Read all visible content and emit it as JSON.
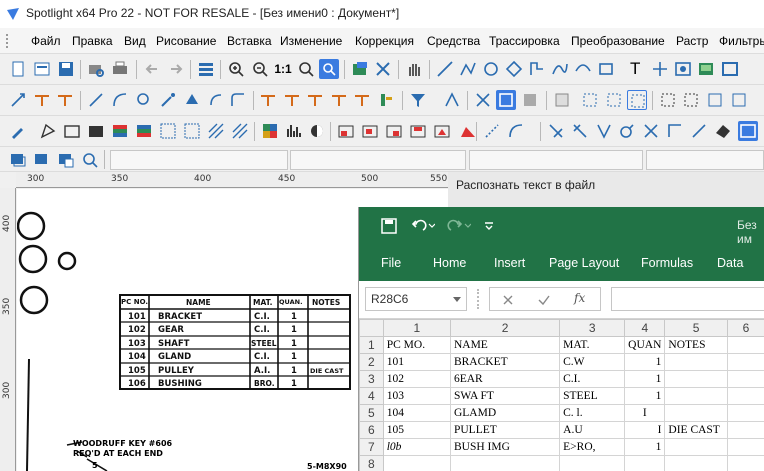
{
  "app": {
    "title": "Spotlight x64 Pro 22 - NOT FOR RESALE - [Без имени0 : Документ*]"
  },
  "menu": [
    "Файл",
    "Правка",
    "Вид",
    "Рисование",
    "Вставка",
    "Изменение",
    "Коррекция",
    "Средства",
    "Трассировка",
    "Преобразование",
    "Растр",
    "Фильтры"
  ],
  "toolbar_icons": {
    "row1": [
      "menu-grip-icon",
      "new-doc-icon",
      "open-icon",
      "save-icon",
      "print-preview-icon",
      "print-icon",
      "back-arrow-icon",
      "forward-arrow-icon",
      "layers-icon",
      "zoom-in-icon",
      "zoom-out-icon",
      "zoom-1to1-icon",
      "zoom-fit-icon",
      "zoom-window-icon",
      "image-icon",
      "transform-icon",
      "pan-hand-icon",
      "line-icon",
      "polyline-icon",
      "circle-icon",
      "rhombus-icon",
      "arc-icon",
      "curve-icon",
      "bezier-icon",
      "rectangle-icon",
      "text-icon",
      "point-icon",
      "insert-image-icon",
      "picture-icon",
      "frame-icon"
    ],
    "row2": [
      "select-icon",
      "linecast-icon",
      "edit-icon",
      "snap-icon",
      "object-select-icon",
      "node-edit-icon",
      "magic-wand-icon",
      "shape-select-icon",
      "mark-icon",
      "color-icon",
      "filter-icon",
      "bezier-icon",
      "cut-icon",
      "crop-icon",
      "gray-area-icon",
      "dotted-select-icon",
      "box-select-icon"
    ],
    "row3": [
      "pick-icon",
      "color-pick-icon",
      "fill-icon",
      "palette-icon",
      "grid-icon",
      "histogram-icon",
      "mask-icon",
      "shape-icon",
      "arc-measure-icon",
      "mirror-icon",
      "transform-icon",
      "image-icon"
    ]
  },
  "zoom_label": "1:1",
  "text_tool": "T",
  "ruler": {
    "h": [
      "300",
      "350",
      "400",
      "450",
      "500",
      "550"
    ],
    "v": [
      "400",
      "350",
      "300"
    ]
  },
  "panel": {
    "header": "Распознать текст в файл"
  },
  "drawing": {
    "table": {
      "headers": [
        "PC NO.",
        "NAME",
        "MAT.",
        "QUAN.",
        "NOTES"
      ],
      "rows": [
        [
          "101",
          "BRACKET",
          "C.I.",
          "1",
          ""
        ],
        [
          "102",
          "GEAR",
          "C.I.",
          "1",
          ""
        ],
        [
          "103",
          "SHAFT",
          "STEEL",
          "1",
          ""
        ],
        [
          "104",
          "GLAND",
          "C.I.",
          "1",
          ""
        ],
        [
          "105",
          "PULLEY",
          "A.I.",
          "1",
          "DIE CAST"
        ],
        [
          "106",
          "BUSHING",
          "BRO.",
          "1",
          ""
        ]
      ]
    },
    "note1": "WOODRUFF KEY #606",
    "note2": "REQ'D AT EACH END",
    "note3": "5",
    "note4": "5-M8X90"
  },
  "excel": {
    "title_text": "Без им",
    "ribbon": [
      "File",
      "Home",
      "Insert",
      "Page Layout",
      "Formulas",
      "Data"
    ],
    "namebox": "R28C6",
    "fx": "fx",
    "col_headers": [
      "1",
      "2",
      "3",
      "4",
      "5",
      "6"
    ],
    "rows": [
      [
        "1",
        "PC MO.",
        "NAME",
        "MAT.",
        "QUAN",
        "NOTES"
      ],
      [
        "2",
        "101",
        "BRACKET",
        "C.W",
        "1",
        ""
      ],
      [
        "3",
        "102",
        "6EAR",
        "C.I.",
        "1",
        ""
      ],
      [
        "4",
        "103",
        "SWA FT",
        "STEEL",
        "1",
        ""
      ],
      [
        "5",
        "104",
        "GLAMD",
        "C. l.",
        "I",
        ""
      ],
      [
        "6",
        "105",
        "PULLET",
        "A.U",
        "I",
        "DIE CAST"
      ],
      [
        "7",
        "l0b",
        "BUSH IMG",
        "E>RO,",
        "1",
        ""
      ],
      [
        "8",
        "",
        "",
        "",
        "",
        ""
      ]
    ]
  }
}
